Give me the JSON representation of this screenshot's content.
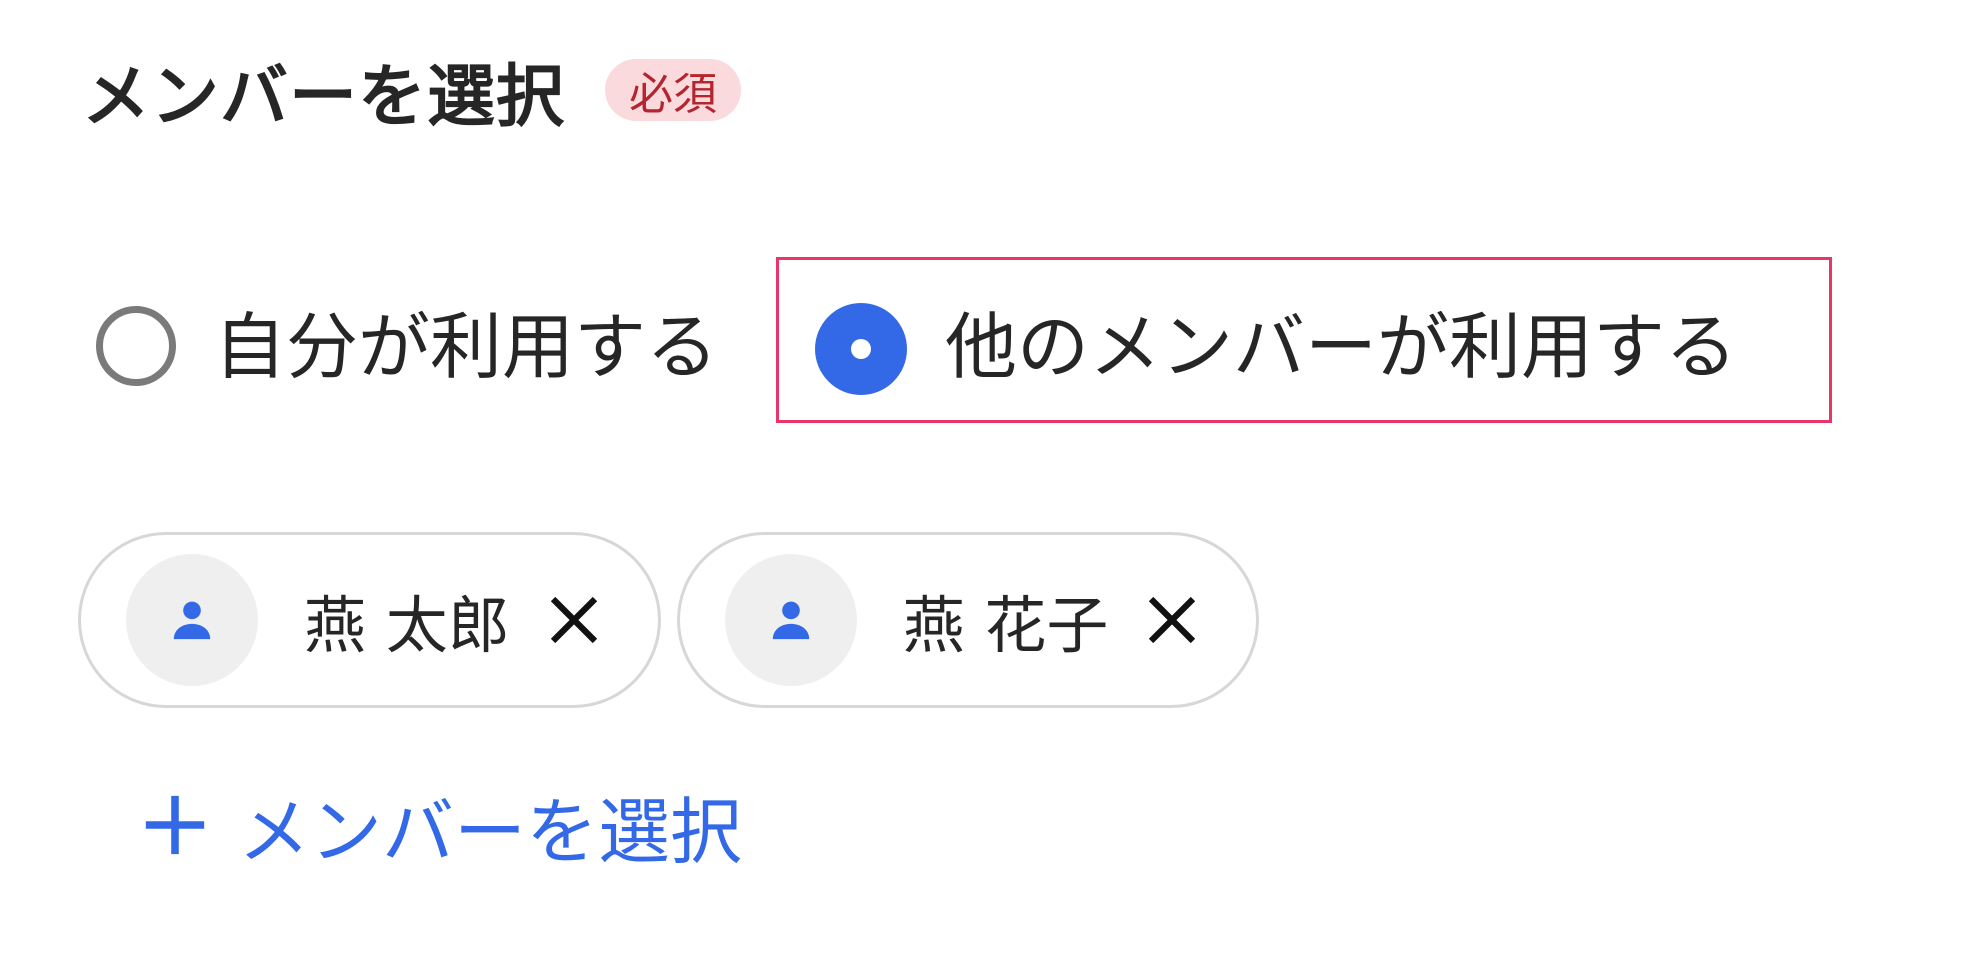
{
  "header": {
    "title": "メンバーを選択",
    "required_badge": "必須"
  },
  "usage_options": [
    {
      "label": "自分が利用する",
      "selected": false
    },
    {
      "label": "他のメンバーが利用する",
      "selected": true
    }
  ],
  "selected_members": [
    {
      "name": "燕 太郎",
      "icon": "person-icon",
      "remove_icon": "close-icon"
    },
    {
      "name": "燕 花子",
      "icon": "person-icon",
      "remove_icon": "close-icon"
    }
  ],
  "add_member": {
    "icon": "plus-icon",
    "label": "メンバーを選択"
  },
  "colors": {
    "accent": "#3369e7",
    "badge_bg": "#fadadd",
    "badge_text": "#b3262f",
    "highlight_border": "#e8356a",
    "chip_border": "#d7d7d7",
    "avatar_bg": "#efefef"
  }
}
